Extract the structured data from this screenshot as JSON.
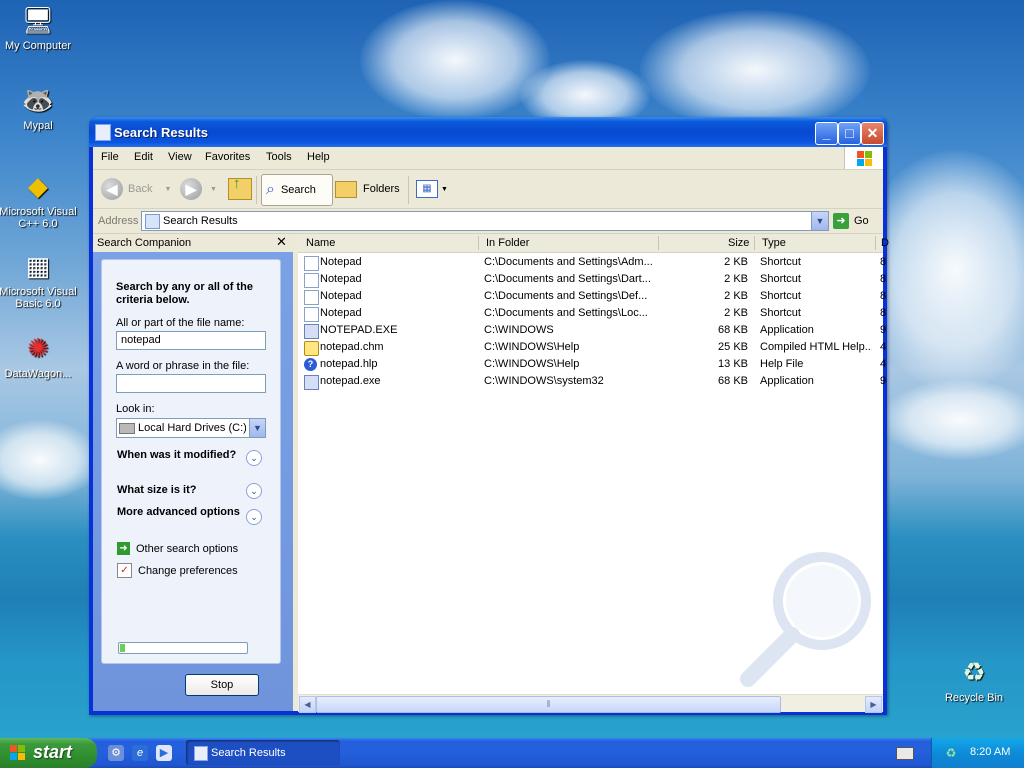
{
  "desktop": {
    "icons": [
      {
        "label": "My Computer"
      },
      {
        "label": "Mypal"
      },
      {
        "label": "Microsoft Visual C++ 6.0"
      },
      {
        "label": "Microsoft Visual Basic 6.0"
      },
      {
        "label": "DataWagon..."
      },
      {
        "label": "Recycle Bin"
      }
    ]
  },
  "window": {
    "title": "Search Results",
    "menu": [
      "File",
      "Edit",
      "View",
      "Favorites",
      "Tools",
      "Help"
    ],
    "toolbar": {
      "back": "Back",
      "search": "Search",
      "folders": "Folders"
    },
    "address": {
      "label": "Address",
      "value": "Search Results",
      "go": "Go"
    }
  },
  "search_companion": {
    "title": "Search Companion",
    "heading": "Search by any or all of the criteria below.",
    "filename_label": "All or part of the file name:",
    "filename_value": "notepad",
    "phrase_label": "A word or phrase in the file:",
    "phrase_value": "",
    "lookin_label": "Look in:",
    "lookin_value": "Local Hard Drives (C:)",
    "when_modified": "When was it modified?",
    "what_size": "What size is it?",
    "more_options": "More advanced options",
    "other_search": "Other search options",
    "change_prefs": "Change preferences",
    "progress_fraction": 0.04,
    "stop": "Stop"
  },
  "results": {
    "columns": [
      "Name",
      "In Folder",
      "Size",
      "Type",
      "D"
    ],
    "rows": [
      {
        "name": "Notepad",
        "folder": "C:\\Documents and Settings\\Adm...",
        "size": "2 KB",
        "type": "Shortcut",
        "date": "8",
        "icon": "shortcut"
      },
      {
        "name": "Notepad",
        "folder": "C:\\Documents and Settings\\Dart...",
        "size": "2 KB",
        "type": "Shortcut",
        "date": "8",
        "icon": "shortcut"
      },
      {
        "name": "Notepad",
        "folder": "C:\\Documents and Settings\\Def...",
        "size": "2 KB",
        "type": "Shortcut",
        "date": "8",
        "icon": "shortcut"
      },
      {
        "name": "Notepad",
        "folder": "C:\\Documents and Settings\\Loc...",
        "size": "2 KB",
        "type": "Shortcut",
        "date": "8",
        "icon": "shortcut"
      },
      {
        "name": "NOTEPAD.EXE",
        "folder": "C:\\WINDOWS",
        "size": "68 KB",
        "type": "Application",
        "date": "9",
        "icon": "app"
      },
      {
        "name": "notepad.chm",
        "folder": "C:\\WINDOWS\\Help",
        "size": "25 KB",
        "type": "Compiled HTML Help...",
        "date": "4",
        "icon": "chm"
      },
      {
        "name": "notepad.hlp",
        "folder": "C:\\WINDOWS\\Help",
        "size": "13 KB",
        "type": "Help File",
        "date": "4",
        "icon": "hlp"
      },
      {
        "name": "notepad.exe",
        "folder": "C:\\WINDOWS\\system32",
        "size": "68 KB",
        "type": "Application",
        "date": "9",
        "icon": "app"
      }
    ]
  },
  "taskbar": {
    "start": "start",
    "task": "Search Results",
    "clock": "8:20 AM"
  },
  "colors": {
    "titlebar": "#0a5bdc",
    "taskbar": "#245edb",
    "start": "#3c9a3c",
    "tray": "#0e8bd8"
  }
}
